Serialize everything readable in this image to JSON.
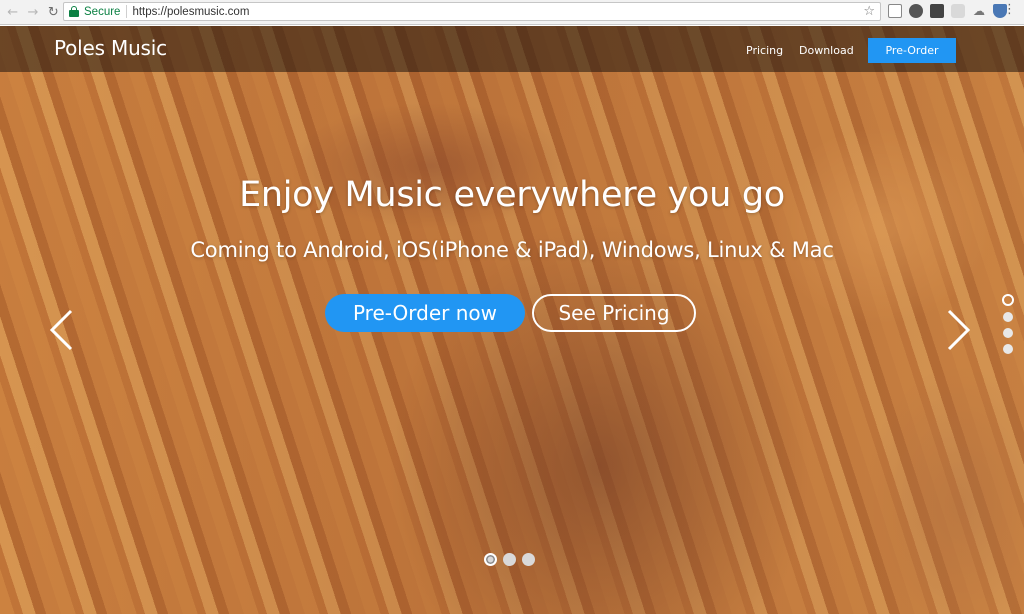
{
  "browser": {
    "secure_label": "Secure",
    "url": "https://polesmusic.com",
    "back_icon": "←",
    "forward_icon": "→",
    "reload_icon": "↻",
    "star_icon": "☆",
    "menu_icon": "⋮"
  },
  "navbar": {
    "brand": "Poles Music",
    "links": [
      "Pricing",
      "Download"
    ],
    "cta": "Pre-Order",
    "cta_color": "#2196f3"
  },
  "hero": {
    "headline": "Enjoy Music everywhere you go",
    "subhead": "Coming to Android, iOS(iPhone & iPad), Windows, Linux & Mac",
    "primary_button": "Pre-Order now",
    "secondary_button": "See Pricing"
  },
  "carousel": {
    "slide_count": 3,
    "active_slide": 1,
    "side_indicator_count": 4,
    "side_active": 1
  }
}
